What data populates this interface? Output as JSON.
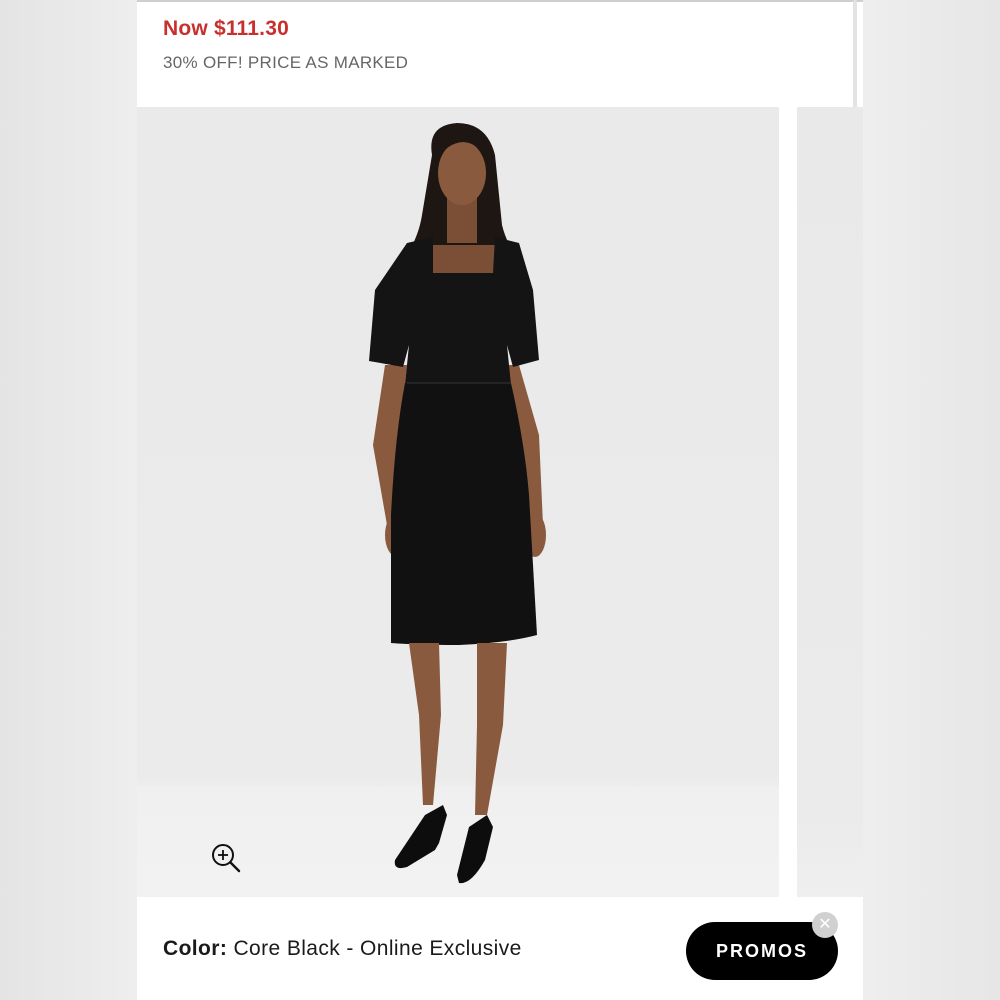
{
  "price": {
    "now": "Now $111.30",
    "promo_text": "30% OFF! PRICE AS MARKED"
  },
  "product_image": {
    "description_icon": "zoom-in-icon"
  },
  "color": {
    "label": "Color:",
    "value": "Core Black - Online Exclusive"
  },
  "promos_button": {
    "label": "PROMOS",
    "close_icon": "close-icon"
  },
  "colors": {
    "price_red": "#c8302e",
    "dress": "#111111",
    "button_bg": "#000000"
  }
}
